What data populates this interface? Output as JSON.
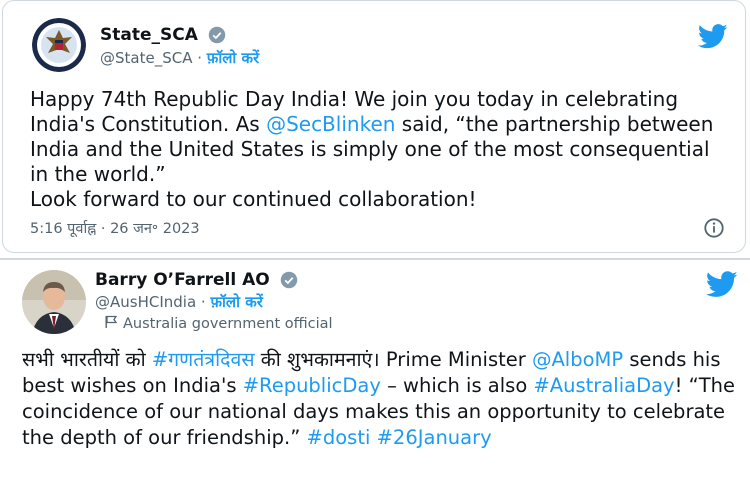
{
  "tweets": [
    {
      "display_name": "State_SCA",
      "handle": "@State_SCA",
      "separator": " · ",
      "follow_label": "फ़ॉलो करें",
      "text_part1": "Happy 74th Republic Day India! We join you today in celebrating India's Constitution. As ",
      "mention": "@SecBlinken",
      "text_part2": " said, “the partnership between India and the United States is simply one of the most consequential in the world.”",
      "text_part3": "Look forward to our continued collaboration!",
      "timestamp": "5:16 पूर्वाह्न · 26 जन॰ 2023",
      "icons": [
        "seal-avatar",
        "verified-badge-icon",
        "twitter-bird-icon",
        "info-icon"
      ]
    },
    {
      "display_name": "Barry O’Farrell AO",
      "handle": "@AusHCIndia",
      "separator": " · ",
      "follow_label": "फ़ॉलो करें",
      "affiliation": "Australia government official",
      "t1": "सभी भारतीयों को ",
      "h1": "#गणतंत्रदिवस",
      "t2": " की शुभकामनाएं। Prime Minister ",
      "m1": "@AlboMP",
      "t3": " sends his best wishes on India's ",
      "h2": "#RepublicDay",
      "t4": " – which is also ",
      "h3": "#AustraliaDay",
      "t5": "! “The coincidence of our national days makes this an opportunity to celebrate the depth of our friendship.” ",
      "h4": "#dosti",
      "t6": " ",
      "h5": "#26January",
      "icons": [
        "profile-photo-avatar",
        "verified-badge-icon",
        "twitter-bird-icon",
        "flag-icon"
      ]
    }
  ],
  "colors": {
    "link": "#1d9bf0",
    "muted": "#536471",
    "text": "#0f1419",
    "border": "#cfd9de"
  }
}
